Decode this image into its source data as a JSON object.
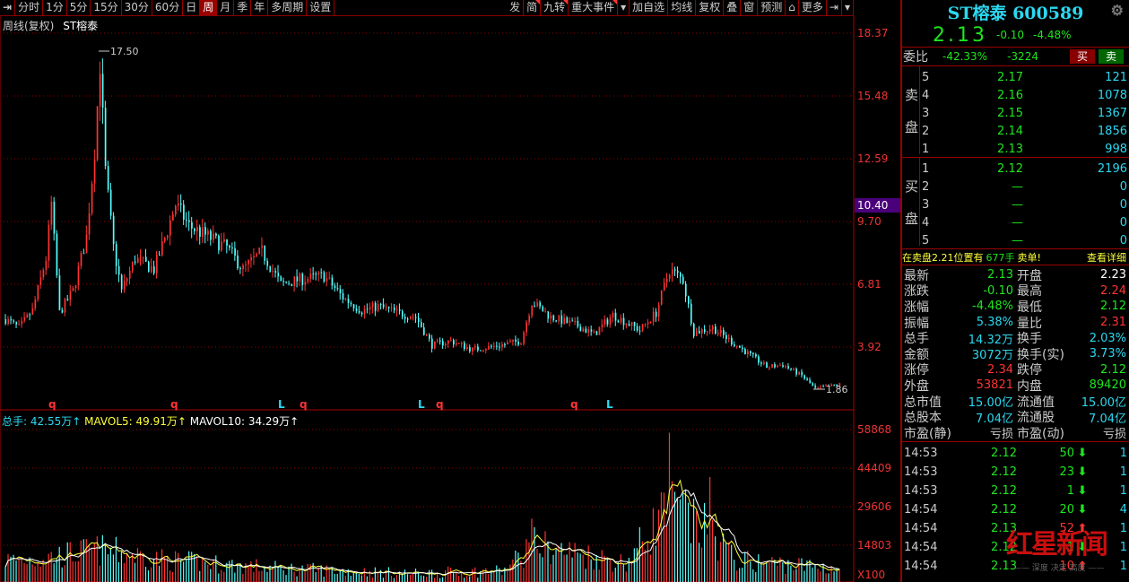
{
  "toolbar": {
    "left_items": [
      "分时",
      "1分",
      "5分",
      "15分",
      "30分",
      "60分",
      "日",
      "周",
      "月",
      "季",
      "年",
      "多周期",
      "设置"
    ],
    "active": "周",
    "right_items": [
      "发",
      "简",
      "九转",
      "重大事件",
      "▾",
      "加自选",
      "均线",
      "复权",
      "叠",
      "窗",
      "预测",
      "⌂",
      "更多",
      "⇥",
      "▾"
    ]
  },
  "chart": {
    "period_label": "周线(复权)",
    "stock_name": "ST榕泰",
    "high_label": "17.50",
    "low_label": "1.86",
    "current_price_tag": "10.40",
    "price_axis": [
      "18.37",
      "15.48",
      "12.59",
      "9.70",
      "6.81",
      "3.92"
    ],
    "vol_axis": [
      "58868",
      "44409",
      "29606",
      "14803",
      "X100"
    ],
    "markers": [
      {
        "t": "q",
        "c": "red"
      },
      {
        "t": "q",
        "c": "red"
      },
      {
        "t": "L",
        "c": "cyan"
      },
      {
        "t": "q",
        "c": "red"
      },
      {
        "t": "L",
        "c": "cyan"
      },
      {
        "t": "q",
        "c": "red"
      },
      {
        "t": "q",
        "c": "red"
      },
      {
        "t": "L",
        "c": "cyan"
      }
    ],
    "vol_legend": {
      "total": "总手: 42.55万↑",
      "ma5": "MAVOL5: 49.91万↑",
      "ma10": "MAVOL10: 34.29万↑"
    }
  },
  "chart_data": {
    "type": "candlestick",
    "candle_count": 310,
    "price_range": [
      1.0,
      18.37
    ],
    "close_anchors": [
      [
        0,
        5.2
      ],
      [
        5,
        4.8
      ],
      [
        10,
        5.6
      ],
      [
        15,
        8.0
      ],
      [
        17,
        10.5
      ],
      [
        20,
        5.5
      ],
      [
        25,
        6.5
      ],
      [
        30,
        9.0
      ],
      [
        33,
        13.0
      ],
      [
        35,
        17.0
      ],
      [
        37,
        12.0
      ],
      [
        40,
        8.5
      ],
      [
        43,
        6.5
      ],
      [
        48,
        8.0
      ],
      [
        55,
        7.5
      ],
      [
        60,
        9.3
      ],
      [
        63,
        10.5
      ],
      [
        68,
        9.5
      ],
      [
        75,
        9.0
      ],
      [
        82,
        8.5
      ],
      [
        88,
        7.5
      ],
      [
        95,
        8.3
      ],
      [
        102,
        6.8
      ],
      [
        108,
        7.0
      ],
      [
        118,
        7.2
      ],
      [
        125,
        6.2
      ],
      [
        132,
        5.6
      ],
      [
        138,
        5.8
      ],
      [
        145,
        5.5
      ],
      [
        152,
        5.3
      ],
      [
        158,
        4.0
      ],
      [
        165,
        4.2
      ],
      [
        173,
        3.8
      ],
      [
        183,
        4.0
      ],
      [
        191,
        4.2
      ],
      [
        195,
        6.0
      ],
      [
        202,
        5.3
      ],
      [
        212,
        4.9
      ],
      [
        218,
        4.5
      ],
      [
        225,
        5.4
      ],
      [
        235,
        4.7
      ],
      [
        241,
        5.5
      ],
      [
        246,
        7.5
      ],
      [
        251,
        7.0
      ],
      [
        255,
        4.6
      ],
      [
        262,
        4.8
      ],
      [
        272,
        3.9
      ],
      [
        282,
        3.0
      ],
      [
        288,
        3.1
      ],
      [
        295,
        2.6
      ],
      [
        300,
        2.0
      ],
      [
        309,
        2.2
      ]
    ],
    "volume_anchors": [
      [
        0,
        9000
      ],
      [
        15,
        10000
      ],
      [
        35,
        13000
      ],
      [
        60,
        9000
      ],
      [
        100,
        6000
      ],
      [
        150,
        4000
      ],
      [
        185,
        5000
      ],
      [
        195,
        15000
      ],
      [
        230,
        8000
      ],
      [
        246,
        30000
      ],
      [
        255,
        22000
      ],
      [
        262,
        20000
      ],
      [
        270,
        9000
      ],
      [
        309,
        6000
      ]
    ],
    "volume_spikes": [
      [
        195,
        25000
      ],
      [
        246,
        58000
      ],
      [
        252,
        36000
      ],
      [
        261,
        41000
      ],
      [
        256,
        28000
      ],
      [
        244,
        35000
      ]
    ],
    "volume_range": [
      0,
      62000
    ]
  },
  "quote": {
    "title": "ST榕泰 600589",
    "price": "2.13",
    "change": "-0.10",
    "pct": "-4.48%",
    "weibi_label": "委比",
    "weibi": "-42.33%",
    "weicha": "-3224",
    "buy_btn": "买",
    "sell_btn": "卖",
    "sell_label": [
      "卖",
      "盘"
    ],
    "buy_label": [
      "买",
      "盘"
    ],
    "asks": [
      {
        "lvl": "5",
        "p": "2.17",
        "v": "121"
      },
      {
        "lvl": "4",
        "p": "2.16",
        "v": "1078"
      },
      {
        "lvl": "3",
        "p": "2.15",
        "v": "1367"
      },
      {
        "lvl": "2",
        "p": "2.14",
        "v": "1856"
      },
      {
        "lvl": "1",
        "p": "2.13",
        "v": "998"
      }
    ],
    "bids": [
      {
        "lvl": "1",
        "p": "2.12",
        "v": "2196"
      },
      {
        "lvl": "2",
        "p": "—",
        "v": "0"
      },
      {
        "lvl": "3",
        "p": "—",
        "v": "0"
      },
      {
        "lvl": "4",
        "p": "—",
        "v": "0"
      },
      {
        "lvl": "5",
        "p": "—",
        "v": "0"
      }
    ],
    "notice": {
      "a": "在卖盘2.21位置有",
      "b": "677手",
      "c": "卖单!",
      "link": "查看详细"
    },
    "stats": [
      [
        "最新",
        "2.13",
        "g",
        "开盘",
        "2.23",
        "w"
      ],
      [
        "涨跌",
        "-0.10",
        "g",
        "最高",
        "2.24",
        "r"
      ],
      [
        "涨幅",
        "-4.48%",
        "g",
        "最低",
        "2.12",
        "g"
      ],
      [
        "振幅",
        "5.38%",
        "c",
        "量比",
        "2.31",
        "r"
      ],
      [
        "总手",
        "14.32万",
        "c",
        "换手",
        "2.03%",
        "c"
      ],
      [
        "金额",
        "3072万",
        "c",
        "换手(实)",
        "3.73%",
        "c"
      ],
      [
        "涨停",
        "2.34",
        "r",
        "跌停",
        "2.12",
        "g"
      ],
      [
        "外盘",
        "53821",
        "r",
        "内盘",
        "89420",
        "g"
      ],
      [
        "总市值",
        "15.00亿",
        "c",
        "流通值",
        "15.00亿",
        "c"
      ],
      [
        "总股本",
        "7.04亿",
        "c",
        "流通股",
        "7.04亿",
        "c"
      ],
      [
        "市盈(静)",
        "亏损",
        "gr",
        "市盈(动)",
        "亏损",
        "gr"
      ]
    ],
    "ticks": [
      {
        "t": "14:53",
        "p": "2.12",
        "v": "50",
        "dir": "down",
        "n": "1"
      },
      {
        "t": "14:53",
        "p": "2.12",
        "v": "23",
        "dir": "down",
        "n": "1"
      },
      {
        "t": "14:53",
        "p": "2.12",
        "v": "1",
        "dir": "down",
        "n": "1"
      },
      {
        "t": "14:54",
        "p": "2.12",
        "v": "20",
        "dir": "down",
        "n": "4"
      },
      {
        "t": "14:54",
        "p": "2.13",
        "v": "52",
        "dir": "up",
        "n": "1"
      },
      {
        "t": "14:54",
        "p": "2.12",
        "v": "1",
        "dir": "down",
        "n": "1"
      },
      {
        "t": "14:54",
        "p": "2.13",
        "v": "10",
        "dir": "up",
        "n": "1"
      }
    ]
  },
  "watermark": {
    "logo": "红星新闻",
    "slogan": "深度 决定 高度"
  },
  "colors": {
    "up": "#ff3333",
    "down": "#54ffff",
    "grid": "#8b0000",
    "ma5": "#ffff3c",
    "ma10": "#ffffff"
  }
}
